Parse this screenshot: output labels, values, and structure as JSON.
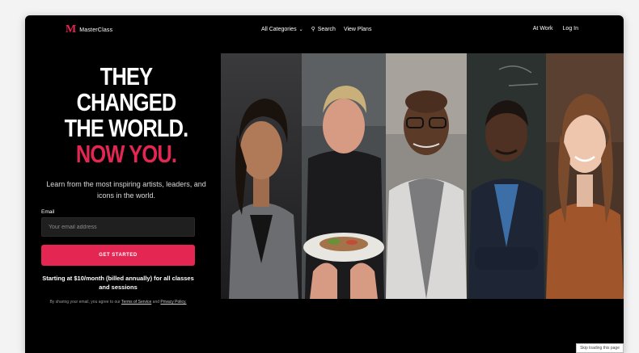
{
  "nav": {
    "logo_text": "MasterClass",
    "logo_mark": "M",
    "categories_label": "All Categories",
    "search_label": "Search",
    "plans_label": "View Plans",
    "at_work_label": "At Work",
    "login_label": "Log In"
  },
  "hero": {
    "line1": "THEY CHANGED",
    "line2": "THE WORLD.",
    "line3": "NOW YOU.",
    "subtext": "Learn from the most inspiring artists, leaders, and icons in the world."
  },
  "form": {
    "email_label": "Email",
    "email_placeholder": "Your email address",
    "email_value": "",
    "cta_label": "GET STARTED",
    "pricing": "Starting at $10/month (billed annually) for all classes and sessions",
    "legal_prefix": "By sharing your email, you agree to our",
    "terms_label": "Terms of Service",
    "legal_and": "and",
    "privacy_label": "Privacy Policy."
  },
  "badge_text": "Skip loading this page",
  "colors": {
    "accent": "#e32652",
    "background": "#000000",
    "input_bg": "#1f1f1f"
  },
  "icons": {
    "categories_chevron": "chevron-down-icon",
    "search": "search-icon"
  }
}
